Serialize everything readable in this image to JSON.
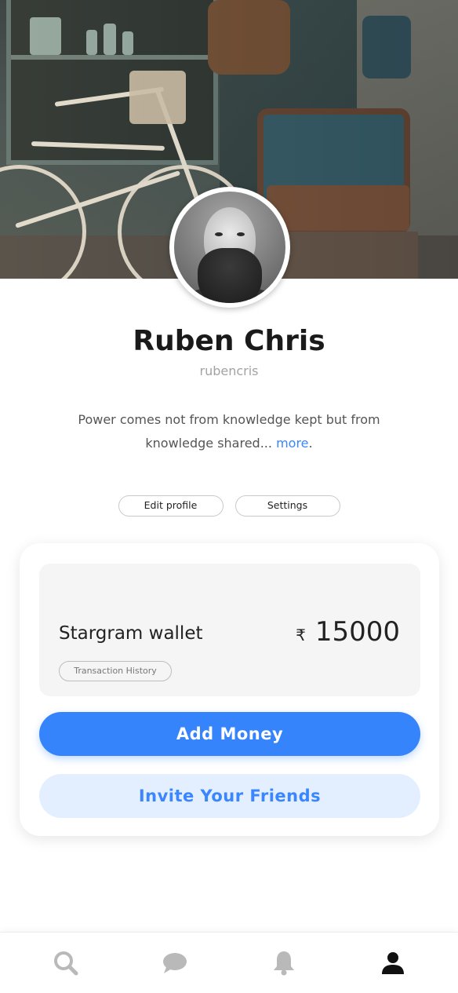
{
  "profile": {
    "name": "Ruben Chris",
    "username": "rubencris",
    "bio": "Power comes not from knowledge kept but from knowledge shared...",
    "bio_more": "more",
    "bio_end": "."
  },
  "actions": {
    "edit_profile": "Edit profile",
    "settings": "Settings"
  },
  "wallet": {
    "label": "Stargram wallet",
    "currency_symbol": "₹",
    "amount": "15000",
    "transaction_history": "Transaction History"
  },
  "buttons": {
    "add_money": "Add Money",
    "invite_friends": "Invite Your Friends"
  },
  "nav": [
    {
      "icon": "search-icon",
      "active": false
    },
    {
      "icon": "chat-icon",
      "active": false
    },
    {
      "icon": "bell-icon",
      "active": false
    },
    {
      "icon": "user-icon",
      "active": true
    }
  ],
  "colors": {
    "accent": "#3684fb",
    "accent_light": "#e3efff",
    "nav_inactive": "#b9b9b9",
    "nav_active": "#111111"
  }
}
